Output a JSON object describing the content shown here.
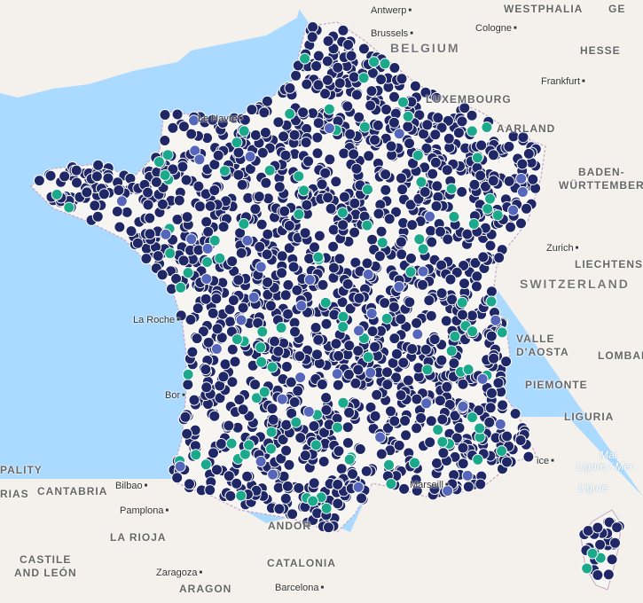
{
  "map": {
    "colors": {
      "sea": "#aadaff",
      "land": "#f4f1ec",
      "france": "#f7f5f1",
      "border": "#c7a6c7",
      "marker_main": "#1f2766",
      "marker_green": "#1aa98a",
      "marker_blue": "#5566bb",
      "marker_stroke": "#ffffff"
    },
    "labels": {
      "antwerp": "Antwerp",
      "westphalia": "WESTPHALIA",
      "ge": "GE",
      "brussels": "Brussels",
      "cologne": "Cologne",
      "belgium": "BELGIUM",
      "hesse": "HESSE",
      "luxembourg": "LUXEMBOURG",
      "frankfurt": "Frankfurt",
      "saarland": "AARLAND",
      "le_havre": "Le Havre",
      "baden": "BADEN-",
      "wurttemberg": "WÜRTTEMBERG",
      "zurich": "Zurich",
      "liechtenstein": "LIECHTENST",
      "switzerland": "SWITZERLAND",
      "la_rochelle": "La Roche",
      "valle": "VALLE",
      "daosta": "D'AOSTA",
      "lombardy": "LOMBAR",
      "piemonte": "PIEMONTE",
      "bordeaux": "Bor",
      "liguria": "LIGURIA",
      "mar_ligure_1": "Mar",
      "mar_ligure_2": "Ligure / Mer",
      "mar_ligure_3": "Ligure",
      "pality": "PALITY",
      "rias": "RIAS",
      "cantabria": "CANTABRIA",
      "bilbao": "Bilbao",
      "pamplona": "Pamplona",
      "marseille": "Marseill",
      "nice": "ice",
      "la_rioja": "LA RIOJA",
      "andorra": "ANDOR",
      "castile_1": "CASTILE",
      "castile_2": "AND LEÓN",
      "catalonia": "CATALONIA",
      "zaragoza": "Zaragoza",
      "aragon": "ARAGON",
      "barcelona": "Barcelona"
    },
    "markers": {
      "total_main": 1700,
      "total_green": 110,
      "total_blue": 45,
      "seed": 7
    }
  }
}
